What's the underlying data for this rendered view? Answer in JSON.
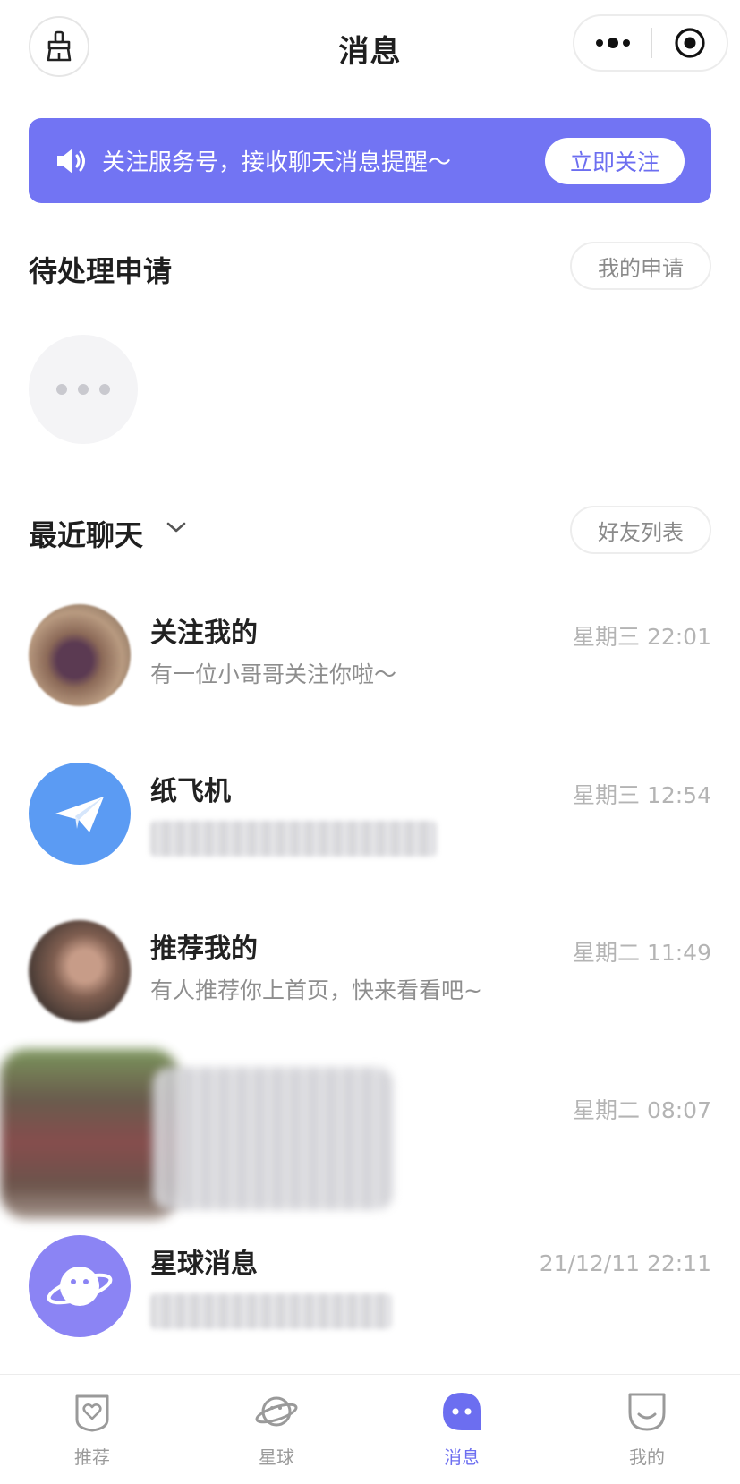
{
  "header": {
    "title": "消息",
    "clean_icon": "broom-icon",
    "more_icon": "ellipsis-icon",
    "close_icon": "target-icon"
  },
  "banner": {
    "text": "关注服务号，接收聊天消息提醒～",
    "button": "立即关注",
    "icon": "speaker-icon",
    "color": "#7274f3"
  },
  "pending": {
    "title": "待处理申请",
    "button": "我的申请"
  },
  "recent": {
    "title": "最近聊天",
    "button": "好友列表"
  },
  "chats": [
    {
      "name": "关注我的",
      "preview": "有一位小哥哥关注你啦～",
      "time": "星期三 22:01",
      "avatar": "photo-avatar"
    },
    {
      "name": "纸飞机",
      "preview": "",
      "time": "星期三 12:54",
      "avatar": "paper-plane-icon"
    },
    {
      "name": "推荐我的",
      "preview": "有人推荐你上首页，快来看看吧~",
      "time": "星期二 11:49",
      "avatar": "photo-avatar"
    },
    {
      "name": "",
      "preview": "",
      "time": "星期二 08:07",
      "avatar": "photo-avatar"
    },
    {
      "name": "星球消息",
      "preview": "",
      "time": "21/12/11 22:11",
      "avatar": "planet-icon"
    }
  ],
  "tabs": [
    {
      "label": "推荐",
      "icon": "heart-shield-icon",
      "active": false
    },
    {
      "label": "星球",
      "icon": "planet-icon",
      "active": false
    },
    {
      "label": "消息",
      "icon": "chat-bubble-icon",
      "active": true
    },
    {
      "label": "我的",
      "icon": "smile-face-icon",
      "active": false
    }
  ],
  "accent_color": "#6c6ef0"
}
